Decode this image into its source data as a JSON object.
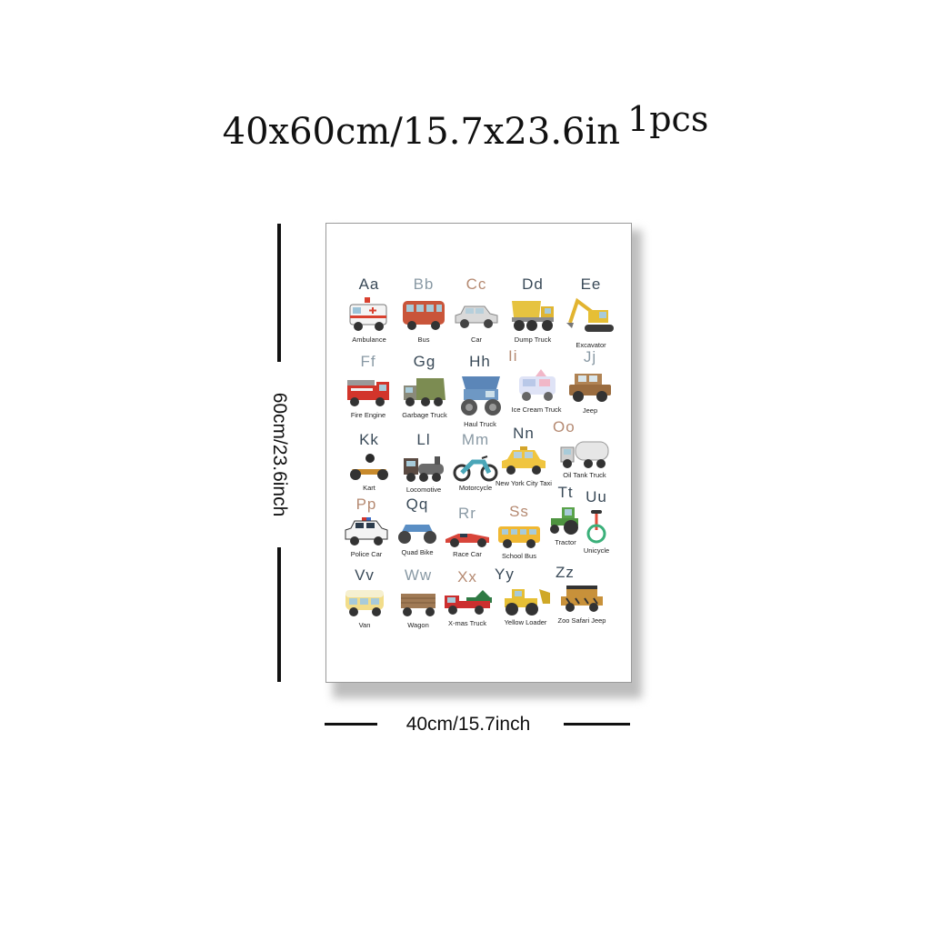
{
  "title": {
    "main": "40x60cm/15.7x23.6in",
    "quantity": "1pcs"
  },
  "dimensions": {
    "height_label": "60cm/23.6inch",
    "width_label": "40cm/15.7inch"
  },
  "poster": {
    "items": [
      {
        "letter": "Aa",
        "name": "Ambulance",
        "icon": "ambulance-icon"
      },
      {
        "letter": "Bb",
        "name": "Bus",
        "icon": "bus-icon"
      },
      {
        "letter": "Cc",
        "name": "Car",
        "icon": "car-icon"
      },
      {
        "letter": "Dd",
        "name": "Dump Truck",
        "icon": "dump-truck-icon"
      },
      {
        "letter": "Ee",
        "name": "Excavator",
        "icon": "excavator-icon"
      },
      {
        "letter": "Ff",
        "name": "Fire Engine",
        "icon": "fire-engine-icon"
      },
      {
        "letter": "Gg",
        "name": "Garbage Truck",
        "icon": "garbage-truck-icon"
      },
      {
        "letter": "Hh",
        "name": "Haul Truck",
        "icon": "haul-truck-icon"
      },
      {
        "letter": "Ii",
        "name": "Ice Cream Truck",
        "icon": "ice-cream-truck-icon"
      },
      {
        "letter": "Jj",
        "name": "Jeep",
        "icon": "jeep-icon"
      },
      {
        "letter": "Kk",
        "name": "Kart",
        "icon": "kart-icon"
      },
      {
        "letter": "Ll",
        "name": "Locomotive",
        "icon": "locomotive-icon"
      },
      {
        "letter": "Mm",
        "name": "Motorcycle",
        "icon": "motorcycle-icon"
      },
      {
        "letter": "Nn",
        "name": "New York City Taxi",
        "icon": "taxi-icon"
      },
      {
        "letter": "Oo",
        "name": "Oil Tank Truck",
        "icon": "oil-tank-truck-icon"
      },
      {
        "letter": "Pp",
        "name": "Police Car",
        "icon": "police-car-icon"
      },
      {
        "letter": "Qq",
        "name": "Quad Bike",
        "icon": "quad-bike-icon"
      },
      {
        "letter": "Rr",
        "name": "Race Car",
        "icon": "race-car-icon"
      },
      {
        "letter": "Ss",
        "name": "School Bus",
        "icon": "school-bus-icon"
      },
      {
        "letter": "Tt",
        "name": "Tractor",
        "icon": "tractor-icon"
      },
      {
        "letter": "Uu",
        "name": "Unicycle",
        "icon": "unicycle-icon"
      },
      {
        "letter": "Vv",
        "name": "Van",
        "icon": "van-icon"
      },
      {
        "letter": "Ww",
        "name": "Wagon",
        "icon": "wagon-icon"
      },
      {
        "letter": "Xx",
        "name": "X-mas Truck",
        "icon": "xmas-truck-icon"
      },
      {
        "letter": "Yy",
        "name": "Yellow Loader",
        "icon": "loader-icon"
      },
      {
        "letter": "Zz",
        "name": "Zoo Safari Jeep",
        "icon": "safari-jeep-icon"
      }
    ]
  }
}
